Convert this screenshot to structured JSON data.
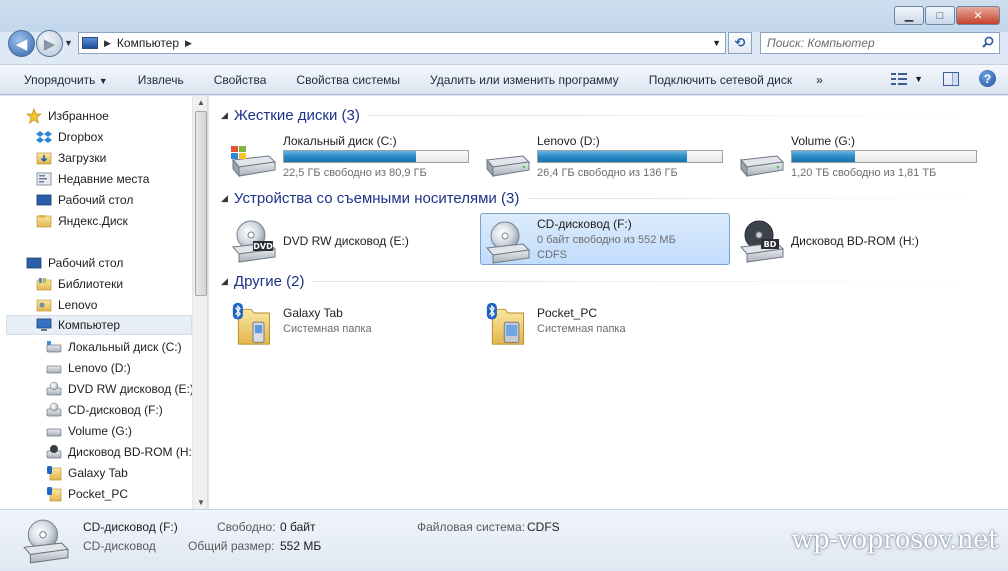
{
  "address": {
    "path": "Компьютер"
  },
  "search": {
    "placeholder": "Поиск: Компьютер"
  },
  "toolbar": {
    "organize": "Упорядочить",
    "eject": "Извлечь",
    "properties": "Свойства",
    "system_properties": "Свойства системы",
    "uninstall": "Удалить или изменить программу",
    "map_drive": "Подключить сетевой диск",
    "more": "»"
  },
  "nav": {
    "favorites": "Избранное",
    "dropbox": "Dropbox",
    "downloads": "Загрузки",
    "recent": "Недавние места",
    "desktop_fav": "Рабочий стол",
    "yandex": "Яндекс.Диск",
    "desktop": "Рабочий стол",
    "libraries": "Библиотеки",
    "lenovo_user": "Lenovo",
    "computer": "Компьютер",
    "drive_c": "Локальный диск (C:)",
    "drive_d": "Lenovo (D:)",
    "drive_e": "DVD RW дисковод (E:)",
    "drive_f": "CD-дисковод (F:)",
    "drive_g": "Volume (G:)",
    "drive_h": "Дисковод BD-ROM (H:)",
    "galaxy": "Galaxy Tab",
    "pocket": "Pocket_PC"
  },
  "groups": {
    "hdd": "Жесткие диски (3)",
    "removable": "Устройства со съемными носителями (3)",
    "other": "Другие (2)"
  },
  "hdd": [
    {
      "name": "Локальный диск (C:)",
      "free": "22,5 ГБ свободно из 80,9 ГБ",
      "used_fraction": 0.72
    },
    {
      "name": "Lenovo (D:)",
      "free": "26,4 ГБ свободно из 136 ГБ",
      "used_fraction": 0.81
    },
    {
      "name": "Volume (G:)",
      "free": "1,20 ТБ свободно из 1,81 ТБ",
      "used_fraction": 0.34
    }
  ],
  "removable": [
    {
      "name": "DVD RW дисковод (E:)",
      "badge": "DVD"
    },
    {
      "name": "CD-дисковод (F:)",
      "free": "0 байт свободно из 552 МБ",
      "fs": "CDFS"
    },
    {
      "name": "Дисковод BD-ROM (H:)",
      "badge": "BD"
    }
  ],
  "other": [
    {
      "name": "Galaxy Tab",
      "sub": "Системная папка"
    },
    {
      "name": "Pocket_PC",
      "sub": "Системная папка"
    }
  ],
  "details": {
    "name": "CD-дисковод (F:)",
    "type": "CD-дисковод",
    "free_label": "Свободно:",
    "free_value": "0 байт",
    "total_label": "Общий размер:",
    "total_value": "552 МБ",
    "fs_label": "Файловая система:",
    "fs_value": "CDFS"
  },
  "watermark": "wp-voprosov.net",
  "colors": {
    "accent_blue": "#1e3287",
    "bar_fill": "#2a8bc4",
    "selection": "#c1dcfc"
  }
}
